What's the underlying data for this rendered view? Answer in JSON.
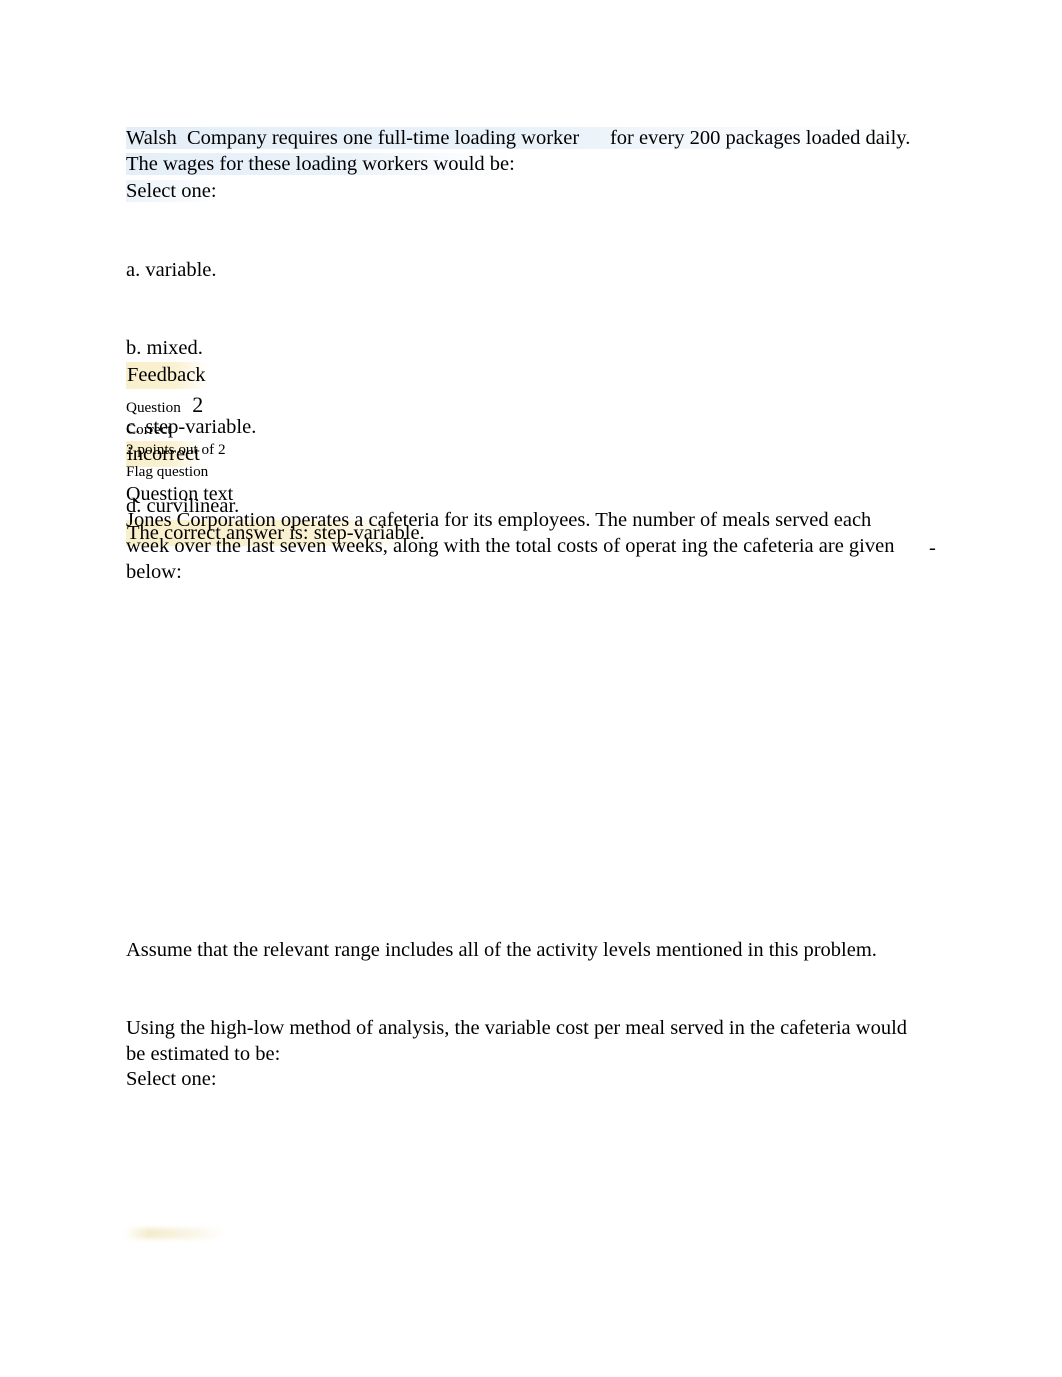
{
  "document": {
    "page_background": "#ffffff",
    "highlight_blue": "#e8f1f9",
    "highlight_yellow": "#f9eec8"
  },
  "question1": {
    "stem": "Walsh  Company requires one full-time loading worker      for every 200 packages loaded daily. The wages for these loading workers would be:",
    "select_prompt": "Select one:",
    "options": [
      "a. variable.",
      "b. mixed.",
      "c. step-variable.",
      "d. curvilinear."
    ],
    "feedback": {
      "heading": "Feedback",
      "result": "incorrect",
      "correct_answer": "The correct answer is: step-variable."
    }
  },
  "question2": {
    "number_label": "Question",
    "number": "2",
    "status": "Correct",
    "points": "2 points out of 2",
    "flag_action": "Flag question",
    "text_label": "Question text",
    "body": "Jones Corporation operates a cafeteria for its employees. The number of meals served each week over the last seven weeks, along with the total costs of operat ing the cafeteria are given below:",
    "dangling_hyphen": "-",
    "assume_paragraph": "Assume that the relevant range includes all of the activity levels mentioned in this problem.",
    "using_paragraph": "Using the high-low method of analysis, the variable cost per meal served in the cafeteria would be estimated to be:",
    "select_prompt": "Select one:"
  }
}
